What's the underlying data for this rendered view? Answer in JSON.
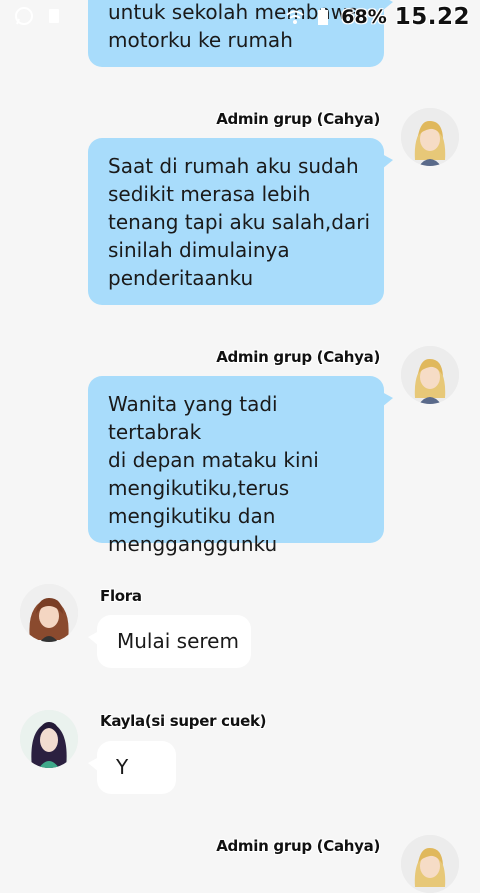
{
  "status_bar": {
    "battery": "68%",
    "time": "15.22",
    "icons": [
      "whatsapp-icon",
      "sim-icon",
      "wifi-icon",
      "battery-icon"
    ]
  },
  "messages": [
    {
      "id": "msg-1",
      "side": "right",
      "text": "untuk sekolah membawa\nmotorku ke rumah"
    },
    {
      "id": "msg-2",
      "side": "right",
      "sender": "Admin grup (Cahya)",
      "avatar": "avatar-cahya",
      "text": "Saat di rumah aku sudah\nsedikit merasa lebih\ntenang tapi aku salah,dari\nsinilah dimulainya\npenderitaanku"
    },
    {
      "id": "msg-3",
      "side": "right",
      "sender": "Admin grup (Cahya)",
      "avatar": "avatar-cahya",
      "text": "Wanita yang tadi tertabrak\ndi depan mataku kini\nmengikutiku,terus\nmengikutiku dan\nmengganggunku"
    },
    {
      "id": "msg-4",
      "side": "left",
      "sender": "Flora",
      "avatar": "avatar-flora",
      "text": "Mulai serem"
    },
    {
      "id": "msg-5",
      "side": "left",
      "sender": "Kayla(si super cuek)",
      "avatar": "avatar-kayla",
      "text": "Y"
    },
    {
      "id": "msg-6",
      "side": "right",
      "sender": "Admin grup (Cahya)",
      "avatar": "avatar-cahya"
    }
  ],
  "colors": {
    "background": "#f6f6f6",
    "bubble_right": "#a8dcfb",
    "bubble_left": "#ffffff"
  }
}
